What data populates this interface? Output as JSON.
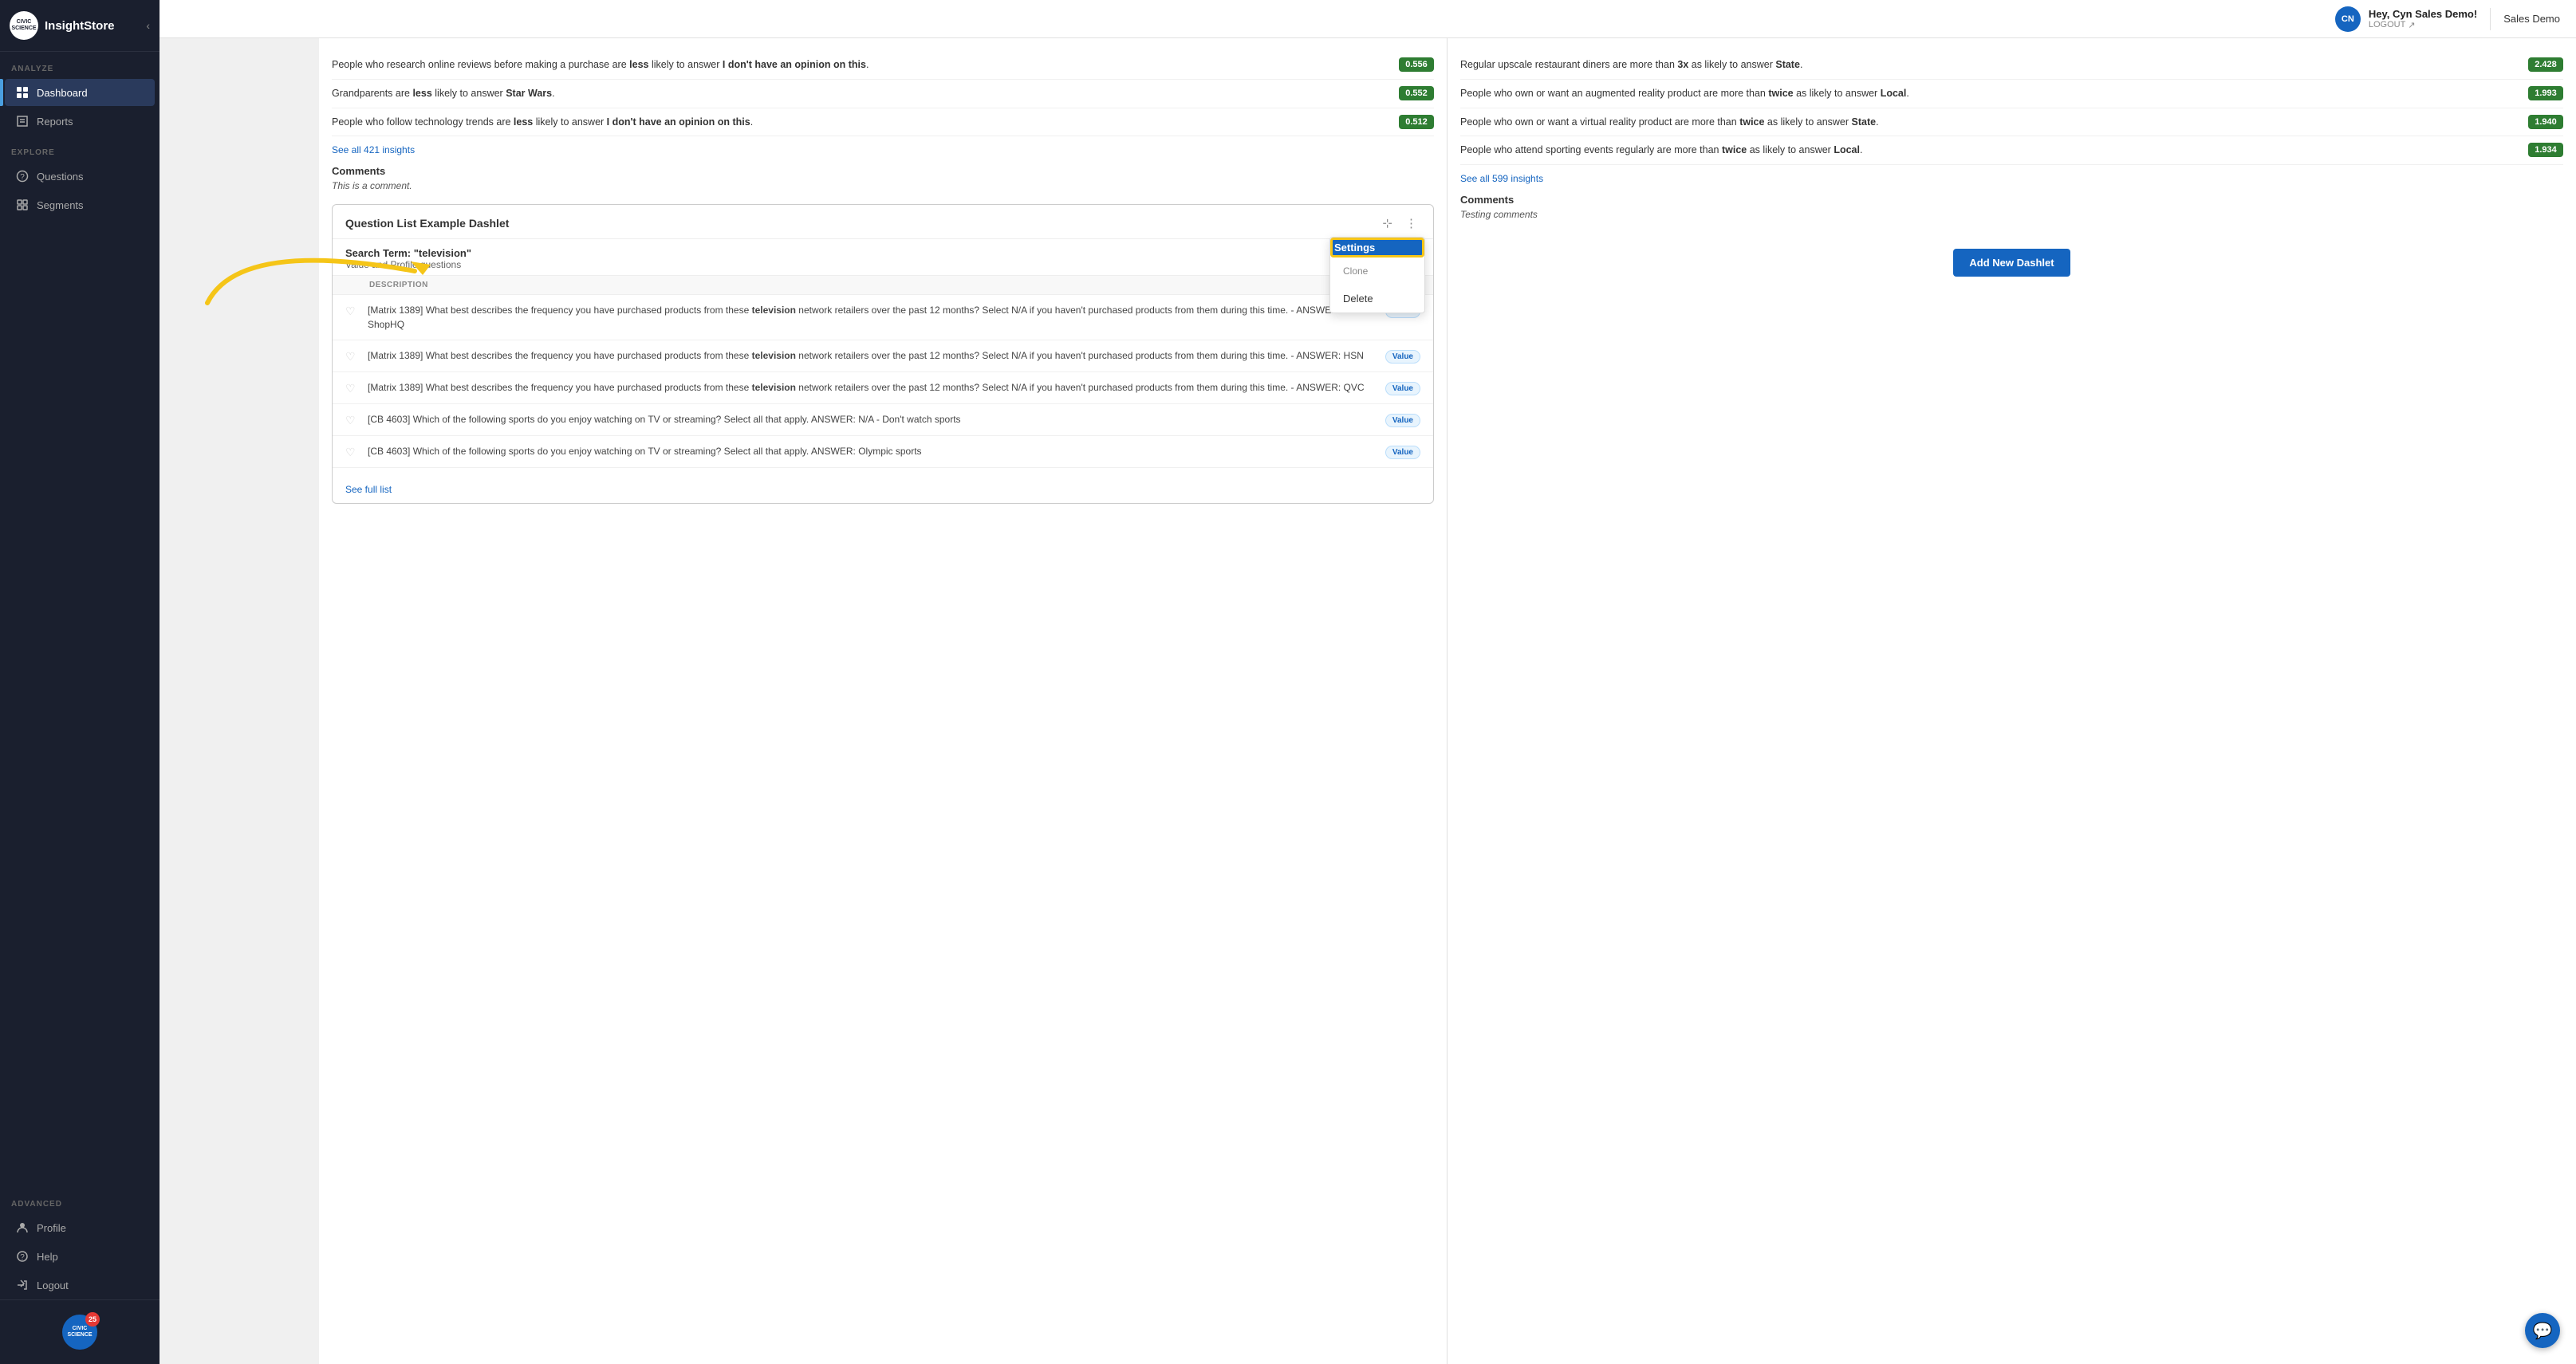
{
  "app": {
    "logo_text": "InsightStore",
    "logo_icon": "CIVIC\nSCIENCE"
  },
  "header": {
    "user_initials": "CN",
    "greeting": "Hey, Cyn Sales Demo!",
    "logout_label": "LOGOUT",
    "sales_demo": "Sales Demo"
  },
  "sidebar": {
    "analyze_label": "ANALYZE",
    "explore_label": "EXPLORE",
    "advanced_label": "ADVANCED",
    "items": [
      {
        "label": "Dashboard",
        "active": true
      },
      {
        "label": "Reports",
        "active": false
      },
      {
        "label": "Questions",
        "active": false
      },
      {
        "label": "Segments",
        "active": false
      },
      {
        "label": "Profile",
        "active": false
      },
      {
        "label": "Help",
        "active": false
      },
      {
        "label": "Logout",
        "active": false
      }
    ],
    "badge_count": "25",
    "badge_label": "CIVIC\nSCIENCE"
  },
  "left_panel": {
    "insights": [
      {
        "text_html": "People who research online reviews before making a purchase are <strong>less</strong> likely to answer <strong>I don't have an opinion on this</strong>.",
        "score": "0.556"
      },
      {
        "text_html": "Grandparents are <strong>less</strong> likely to answer <strong>Star Wars</strong>.",
        "score": "0.552"
      },
      {
        "text_html": "People who follow technology trends are <strong>less</strong> likely to answer <strong>I don't have an opinion on this</strong>.",
        "score": "0.512"
      }
    ],
    "see_all_link": "See all 421 insights",
    "comments_title": "Comments",
    "comments_text": "This is a comment.",
    "dashlet_title": "Question List Example Dashlet",
    "search_term": "Search Term: \"television\"",
    "search_sub": "Value and Profile questions",
    "col_description": "DESCRIPTION",
    "questions": [
      {
        "text_html": "[Matrix 1389] What best describes the frequency you have purchased products from these <strong>television</strong> network retailers over the past 12 months? Select N/A if you haven't purchased products from them during this time. - ANSWER: ShopHQ",
        "tag": "Value"
      },
      {
        "text_html": "[Matrix 1389] What best describes the frequency you have purchased products from these <strong>television</strong> network retailers over the past 12 months? Select N/A if you haven't purchased products from them during this time. - ANSWER: HSN",
        "tag": "Value"
      },
      {
        "text_html": "[Matrix 1389] What best describes the frequency you have purchased products from these <strong>television</strong> network retailers over the past 12 months? Select N/A if you haven't purchased products from them during this time. - ANSWER: QVC",
        "tag": "Value"
      },
      {
        "text_html": "[CB 4603] Which of the following sports do you enjoy watching on TV or streaming? Select all that apply. ANSWER: N/A - Don't watch sports",
        "tag": "Value"
      },
      {
        "text_html": "[CB 4603] Which of the following sports do you enjoy watching on TV or streaming? Select all that apply. ANSWER: Olympic sports",
        "tag": "Value"
      }
    ],
    "see_full_list": "See full list",
    "dropdown_settings": "Settings",
    "dropdown_clone": "Clone",
    "dropdown_delete": "Delete"
  },
  "right_panel": {
    "insights": [
      {
        "text_html": "Regular upscale restaurant diners are more than <strong>3x</strong> as likely to answer <strong>State</strong>.",
        "score": "2.428"
      },
      {
        "text_html": "People who own or want an augmented reality product are more than <strong>twice</strong> as likely to answer <strong>Local</strong>.",
        "score": "1.993"
      },
      {
        "text_html": "People who own or want a virtual reality product are more than <strong>twice</strong> as likely to answer <strong>State</strong>.",
        "score": "1.940"
      },
      {
        "text_html": "People who attend sporting events regularly are more than <strong>twice</strong> as likely to answer <strong>Local</strong>.",
        "score": "1.934"
      }
    ],
    "see_all_link": "See all 599 insights",
    "comments_title": "Comments",
    "comments_text": "Testing comments",
    "add_dashlet_btn": "Add New Dashlet"
  },
  "chat_icon": "💬"
}
